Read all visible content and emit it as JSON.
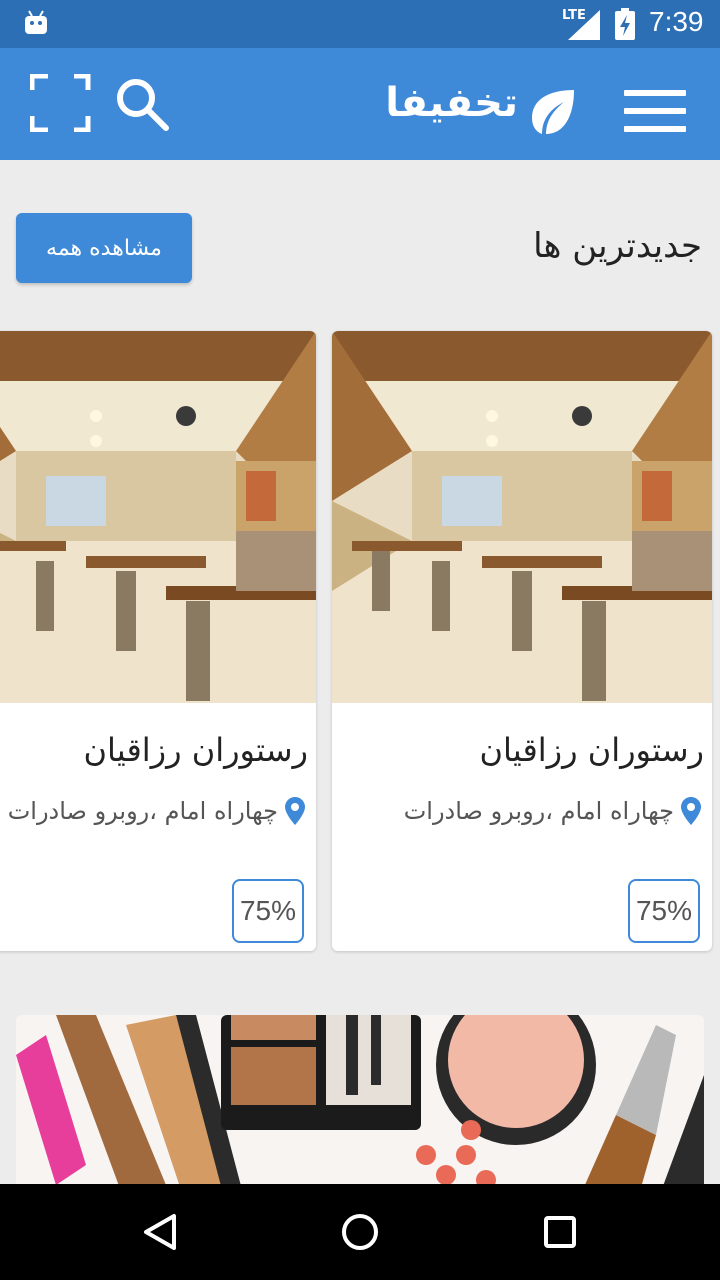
{
  "status_bar": {
    "time": "7:39",
    "network": "LTE",
    "battery_icon": "battery-charging-icon",
    "notification_icon": "android-icon"
  },
  "app_bar": {
    "brand": "تخفیفا",
    "menu_icon": "hamburger-menu-icon",
    "logo_icon": "leaf-icon",
    "search_icon": "search-icon",
    "scan_icon": "scan-icon",
    "color": "#3f89d9"
  },
  "section": {
    "title": "جدیدترین ها",
    "view_all_label": "مشاهده همه"
  },
  "cards": [
    {
      "title": "رستوران رزاقیان",
      "address": "چهاراه امام ،روبرو صادرات",
      "discount": "75%",
      "image": "restaurant-interior"
    },
    {
      "title": "رستوران رزاقیان",
      "address": "چهاراه امام ،روبرو صادرات",
      "discount": "75%",
      "image": "restaurant-interior"
    }
  ],
  "next_card": {
    "image": "makeup-products"
  },
  "nav_bar": {
    "back_icon": "back-icon",
    "home_icon": "home-icon",
    "recent_icon": "recent-apps-icon"
  }
}
